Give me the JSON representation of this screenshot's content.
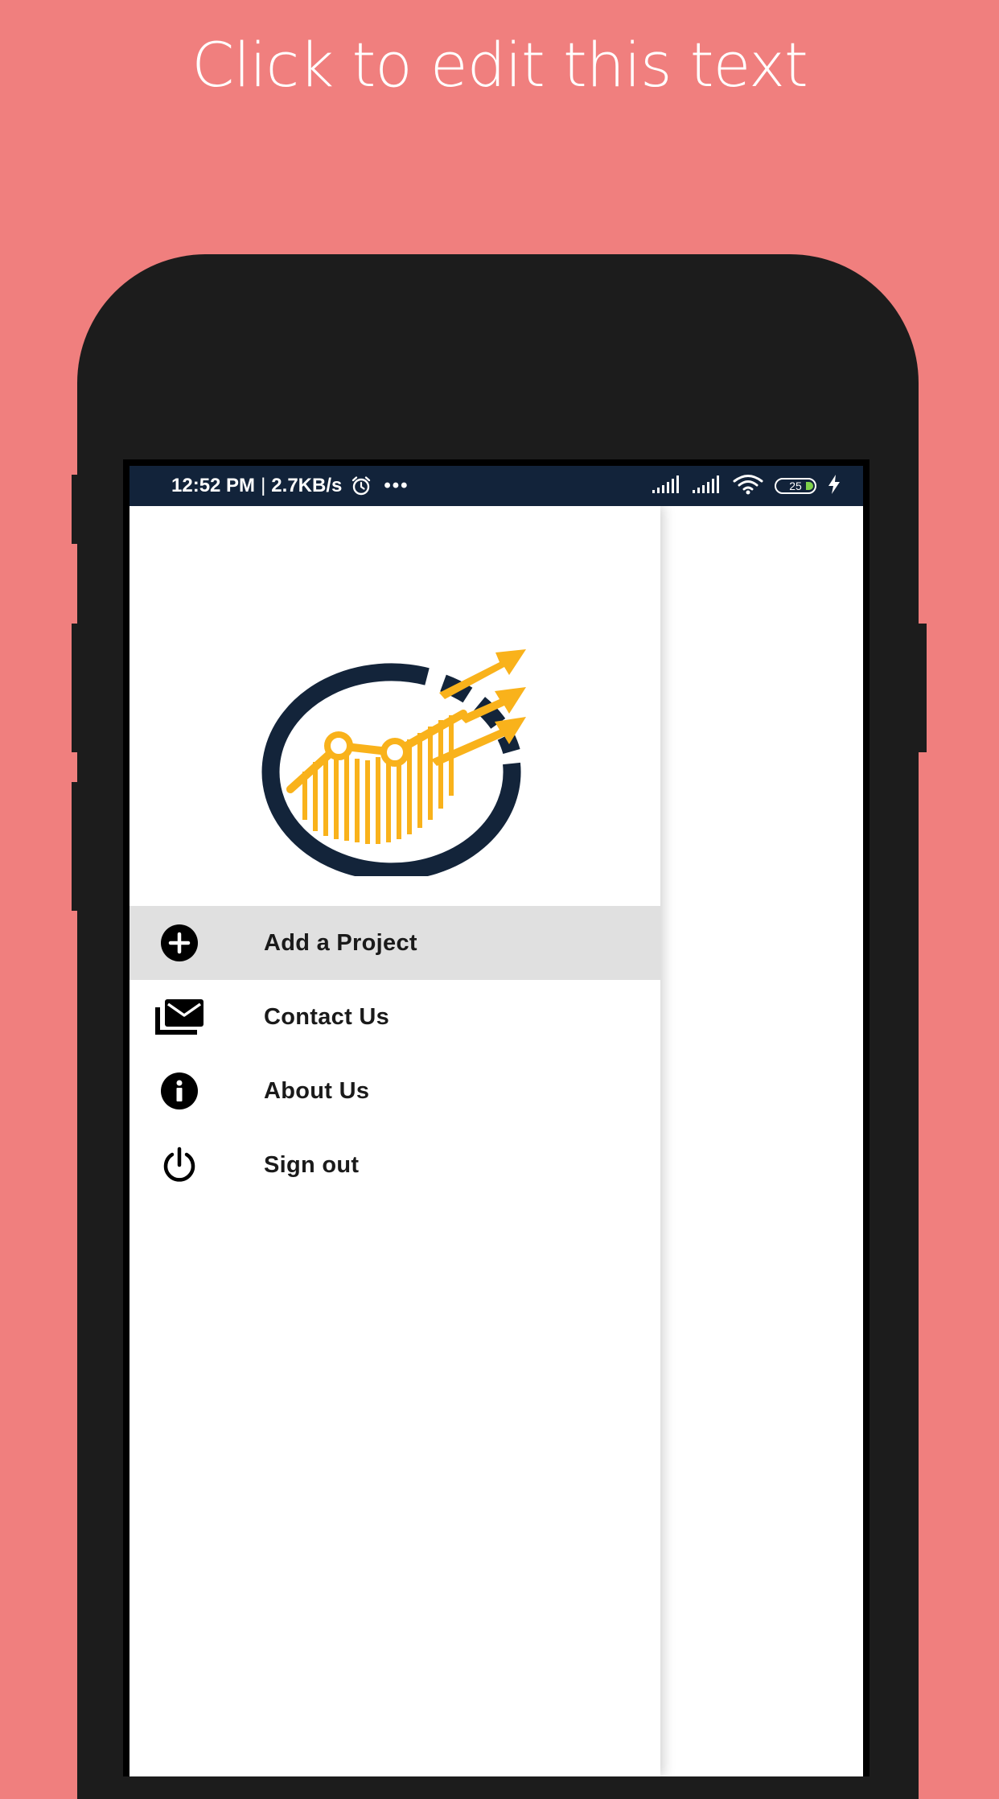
{
  "headline": "Click to edit this text",
  "colors": {
    "background": "#f07f7e",
    "phone_body": "#1c1c1c",
    "status_bar": "#12233a",
    "active_item": "#e0e0e0",
    "logo_navy": "#13243a",
    "logo_gold": "#f9b21b",
    "battery_fill": "#7fd24a"
  },
  "status_bar": {
    "time": "12:52 PM",
    "separator": "|",
    "speed": "2.7KB/s",
    "more": "•••",
    "battery": "25",
    "icons": [
      "alarm-icon",
      "signal-icon",
      "signal-icon",
      "wifi-icon",
      "battery-icon",
      "charging-icon"
    ]
  },
  "drawer": {
    "logo": "growth-chart-logo",
    "menu": [
      {
        "label": "Add a Project",
        "icon": "add-circle-icon",
        "active": true
      },
      {
        "label": "Contact Us",
        "icon": "mail-icon",
        "active": false
      },
      {
        "label": "About Us",
        "icon": "info-icon",
        "active": false
      },
      {
        "label": "Sign out",
        "icon": "power-icon",
        "active": false
      }
    ]
  }
}
